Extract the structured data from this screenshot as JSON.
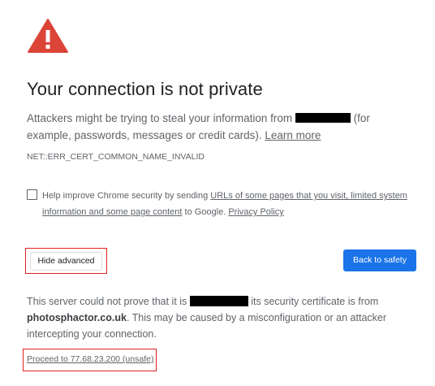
{
  "page": {
    "title": "Your connection is not private",
    "desc_before": "Attackers might be trying to steal your information from ",
    "desc_after": " (for example, passwords, messages or credit cards). ",
    "learn_more": "Learn more",
    "error_code": "NET::ERR_CERT_COMMON_NAME_INVALID",
    "checkbox_prefix": "Help improve Chrome security by sending ",
    "checkbox_link1": "URLs of some pages that you visit, limited system information and some page content",
    "checkbox_mid": " to Google. ",
    "checkbox_link2": "Privacy Policy",
    "hide_advanced": "Hide advanced",
    "back_to_safety": "Back to safety",
    "details_before": "This server could not prove that it is ",
    "details_mid": " its security certificate is from ",
    "details_host": "photosphactor.co.uk",
    "details_after": ". This may be caused by a misconfiguration or an attacker intercepting your connection.",
    "proceed_link": "Proceed to 77.68.23.200 (unsafe)"
  },
  "colors": {
    "warning_red": "#db4437",
    "primary_blue": "#1a73e8",
    "highlight_red": "#e02020"
  },
  "icons": {
    "warning": "warning-triangle-icon"
  }
}
